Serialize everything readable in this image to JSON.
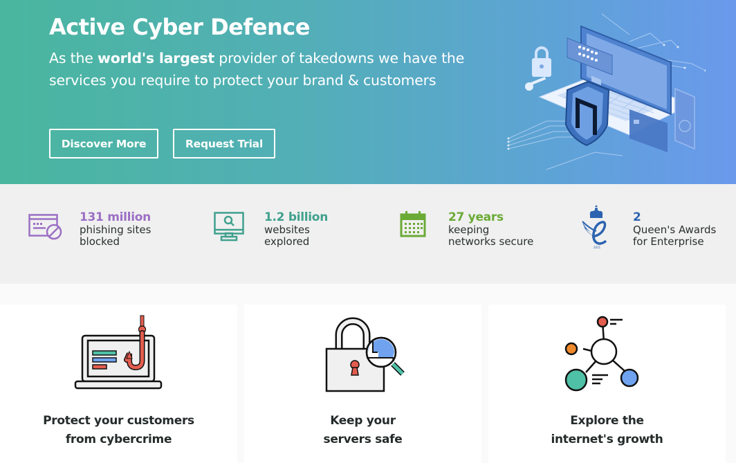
{
  "hero": {
    "title": "Active Cyber Defence",
    "subtitle_pre": "As the ",
    "subtitle_bold": "world's largest",
    "subtitle_post": " provider of takedowns we have the services you require to protect your brand & customers",
    "buttons": {
      "discover": "Discover More",
      "trial": "Request Trial"
    },
    "illustration": "laptop-shield-security-illustration",
    "colors": {
      "gradient_start": "#4ab69f",
      "gradient_end": "#6a99ec"
    }
  },
  "stats": [
    {
      "icon": "blocked-browser-icon",
      "number": "131 million",
      "line1": "phishing sites",
      "line2": "blocked",
      "color": "#9b6fc4"
    },
    {
      "icon": "monitor-search-icon",
      "number": "1.2 billion",
      "line1": "websites",
      "line2": "explored",
      "color": "#3fa08d"
    },
    {
      "icon": "calendar-icon",
      "number": "27 years",
      "line1": "keeping",
      "line2": "networks secure",
      "color": "#6aaa35"
    },
    {
      "icon": "queens-award-icon",
      "number": "2",
      "line1": "Queen's Awards",
      "line2": "for Enterprise",
      "color": "#2c63b0"
    }
  ],
  "cards": [
    {
      "icon": "laptop-phishing-hook-icon",
      "line1": "Protect your customers",
      "line2": "from cybercrime"
    },
    {
      "icon": "padlock-magnifier-icon",
      "line1": "Keep your",
      "line2": "servers safe"
    },
    {
      "icon": "network-nodes-icon",
      "line1": "Explore the",
      "line2": "internet's growth"
    }
  ]
}
